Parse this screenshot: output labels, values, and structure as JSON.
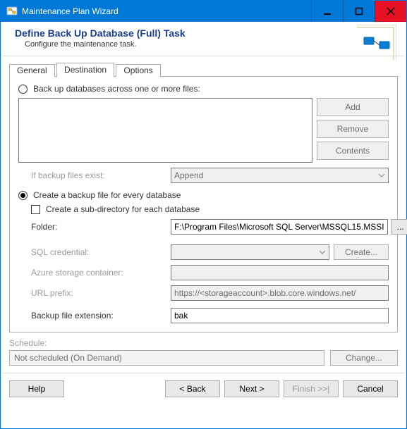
{
  "window": {
    "title": "Maintenance Plan Wizard"
  },
  "header": {
    "title": "Define Back Up Database (Full) Task",
    "subtitle": "Configure the maintenance task."
  },
  "tabs": {
    "general": "General",
    "destination": "Destination",
    "options": "Options"
  },
  "dest": {
    "opt_files": "Back up databases across one or more files:",
    "btn_add": "Add",
    "btn_remove": "Remove",
    "btn_contents": "Contents",
    "if_exist_label": "If backup files exist:",
    "if_exist_value": "Append",
    "opt_every": "Create a backup file for every database",
    "chk_subdir": "Create a sub-directory for each database",
    "folder_label": "Folder:",
    "folder_value": "F:\\Program Files\\Microsoft SQL Server\\MSSQL15.MSSI",
    "browse": "...",
    "sql_cred_label": "SQL credential:",
    "sql_cred_create": "Create...",
    "azure_label": "Azure storage container:",
    "url_label": "URL prefix:",
    "url_value": "https://<storageaccount>.blob.core.windows.net/",
    "ext_label": "Backup file extension:",
    "ext_value": "bak"
  },
  "schedule": {
    "label": "Schedule:",
    "value": "Not scheduled (On Demand)",
    "change": "Change..."
  },
  "nav": {
    "help": "Help",
    "back": "< Back",
    "next": "Next >",
    "finish": "Finish >>|",
    "cancel": "Cancel"
  }
}
